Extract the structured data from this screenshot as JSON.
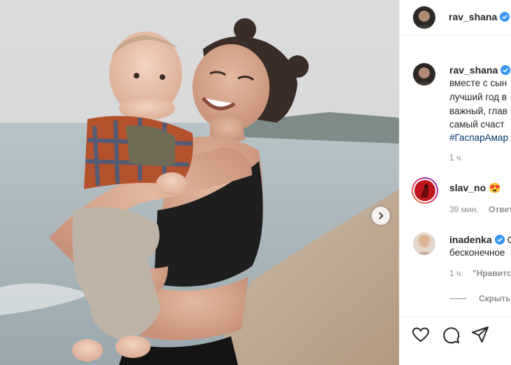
{
  "post_author": {
    "username": "rav_shana",
    "verified": true
  },
  "caption": {
    "username": "rav_shana",
    "lines": [
      "вместе с сын",
      "лучший год в",
      "важный, глав",
      "самый счаст"
    ],
    "hashtag": "#ГаспарАмар",
    "time": "1 ч."
  },
  "comments": [
    {
      "username": "slav_no",
      "emoji": "😍",
      "time": "39 мин.",
      "reply_label": "Ответ"
    },
    {
      "username": "inadenka",
      "verified": true,
      "text_start": "С",
      "text": "бесконечное",
      "time": "1 ч.",
      "like_label": "\"Нравитс"
    }
  ],
  "hide_replies_label": "Скрыть",
  "icons": {
    "like": "heart-icon",
    "comment": "comment-icon",
    "share": "share-icon",
    "carousel_next": "chevron-right-icon",
    "verified": "verified-badge-icon"
  },
  "colors": {
    "verified": "#3897f0",
    "text": "#262626",
    "secondary": "#8e8e8e",
    "hashtag": "#00376b"
  }
}
